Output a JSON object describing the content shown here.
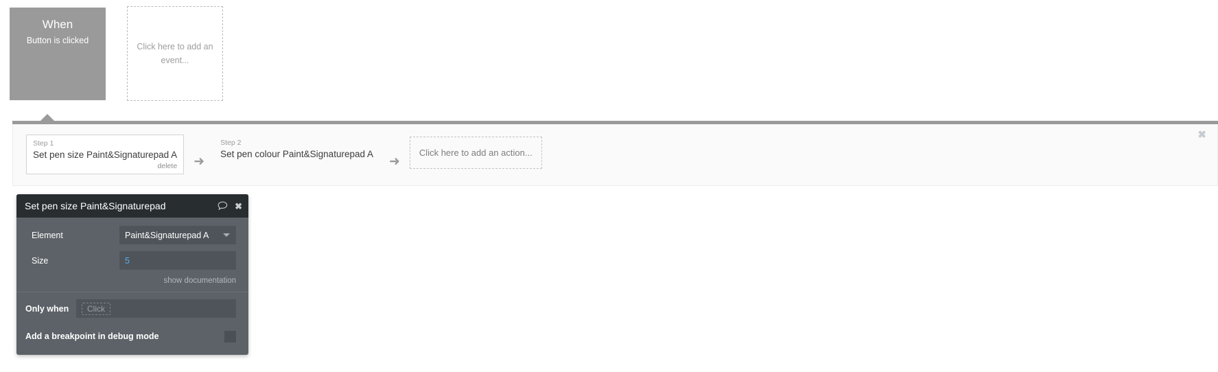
{
  "events": {
    "when_block": {
      "title": "When",
      "subtitle": "Button is clicked"
    },
    "add_event": {
      "label": "Click here to add an event..."
    }
  },
  "workflow": {
    "close_icon": "✖",
    "steps": [
      {
        "number": "Step 1",
        "title": "Set pen size Paint&Signaturepad A",
        "delete_label": "delete",
        "selected": true
      },
      {
        "number": "Step 2",
        "title": "Set pen colour Paint&Signaturepad A",
        "selected": false
      }
    ],
    "arrow_icon": "➜",
    "add_action": {
      "label": "Click here to add an action..."
    }
  },
  "properties_panel": {
    "header": {
      "title": "Set pen size Paint&Signaturepad",
      "comment_icon": "speech-bubble-icon",
      "close_icon": "✖"
    },
    "fields": [
      {
        "label": "Element",
        "value": "Paint&Signaturepad A",
        "type": "dropdown"
      },
      {
        "label": "Size",
        "value": "5",
        "type": "number"
      }
    ],
    "documentation_link": "show documentation",
    "only_when": {
      "label": "Only when",
      "placeholder": "Click"
    },
    "breakpoint": {
      "label": "Add a breakpoint in debug mode",
      "checked": false
    }
  },
  "colors": {
    "event_block": "#9a9a9a",
    "panel_header": "#282d30",
    "panel_body": "#5c6267",
    "field_bg": "#4e5459",
    "number_value": "#5ba9e8"
  }
}
